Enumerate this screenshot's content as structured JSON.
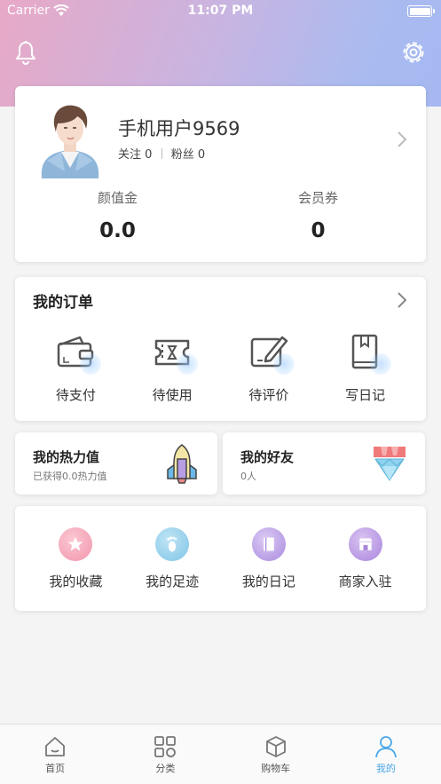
{
  "status_bar": {
    "carrier": "Carrier",
    "time": "11:07 PM"
  },
  "profile": {
    "username": "手机用户9569",
    "follow_label": "关注",
    "follow_count": "0",
    "fans_label": "粉丝",
    "fans_count": "0",
    "stats": [
      {
        "label": "颜值金",
        "value": "0.0"
      },
      {
        "label": "会员券",
        "value": "0"
      }
    ]
  },
  "orders": {
    "title": "我的订单",
    "items": [
      {
        "label": "待支付",
        "icon": "wallet-icon"
      },
      {
        "label": "待使用",
        "icon": "ticket-icon"
      },
      {
        "label": "待评价",
        "icon": "edit-review-icon"
      },
      {
        "label": "写日记",
        "icon": "diary-book-icon"
      }
    ]
  },
  "heat": {
    "title": "我的热力值",
    "subtitle": "已获得0.0热力值",
    "icon": "rocket-icon"
  },
  "friends": {
    "title": "我的好友",
    "subtitle": "0人",
    "icon": "diamond-icon"
  },
  "collect": {
    "items": [
      {
        "label": "我的收藏",
        "icon": "star-icon",
        "color": "#f3a1b3"
      },
      {
        "label": "我的足迹",
        "icon": "footprint-icon",
        "color": "#86c9ea"
      },
      {
        "label": "我的日记",
        "icon": "notebook-icon",
        "color": "#b79de4"
      },
      {
        "label": "商家入驻",
        "icon": "shop-icon",
        "color": "#b990e0"
      }
    ]
  },
  "tabbar": {
    "items": [
      {
        "label": "首页",
        "icon": "home-icon"
      },
      {
        "label": "分类",
        "icon": "category-grid-icon"
      },
      {
        "label": "购物车",
        "icon": "cart-box-icon"
      },
      {
        "label": "我的",
        "icon": "profile-icon"
      }
    ],
    "active_index": 3,
    "active_color": "#4aa8e8"
  }
}
